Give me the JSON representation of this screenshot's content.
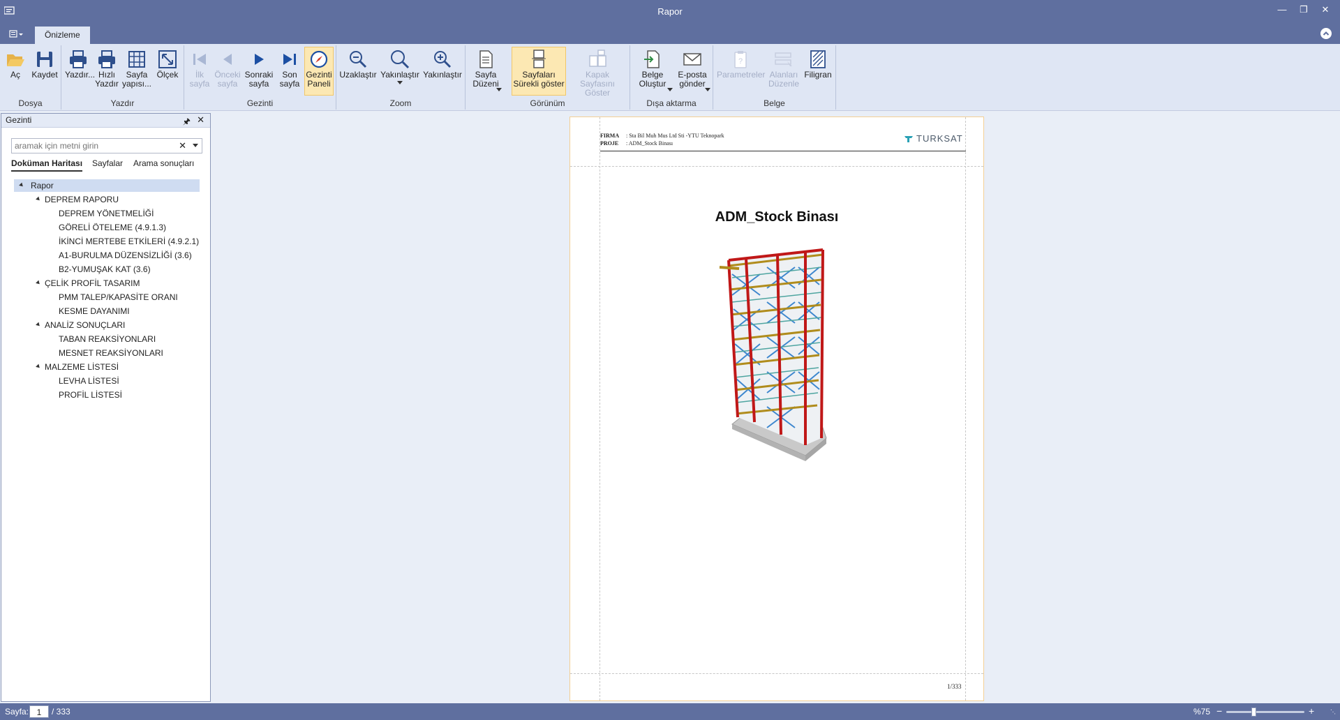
{
  "window": {
    "title": "Rapor"
  },
  "tabs": {
    "active": "Önizleme"
  },
  "ribbon": {
    "groups": {
      "dosya": "Dosya",
      "yazdir": "Yazdır",
      "gezinti": "Gezinti",
      "zoom": "Zoom",
      "gorunum": "Görünüm",
      "disa": "Dışa aktarma",
      "belge": "Belge"
    },
    "buttons": {
      "ac": "Aç",
      "kaydet": "Kaydet",
      "yazdir": "Yazdır...",
      "hizli_yazdir": "Hızlı\nYazdır",
      "sayfa_yapisi": "Sayfa\nyapısı...",
      "olcek": "Ölçek",
      "ilk_sayfa": "İlk\nsayfa",
      "onceki_sayfa": "Önceki\nsayfa",
      "sonraki_sayfa": "Sonraki\nsayfa",
      "son_sayfa": "Son\nsayfa",
      "gezinti_paneli": "Gezinti\nPaneli",
      "uzaklastir": "Uzaklaştır",
      "yakinlastir_dd": "Yakınlaştır",
      "yakinlastir": "Yakınlaştır",
      "sayfa_duzeni": "Sayfa\nDüzeni",
      "surekli_goster": "Sayfaları\nSürekli göster",
      "kapak_goster": "Kapak Sayfasını\nGöster",
      "belge_olustur": "Belge\nOluştur",
      "eposta_gonder": "E-posta\ngönder",
      "parametreler": "Parametreler",
      "alanlari_duzenle": "Alanları\nDüzenle",
      "filigran": "Filigran"
    }
  },
  "nav": {
    "title": "Gezinti",
    "search_placeholder": "aramak için metni girin",
    "tabs": [
      "Doküman Haritası",
      "Sayfalar",
      "Arama sonuçları"
    ],
    "tree": {
      "root": "Rapor",
      "deprem": "DEPREM RAPORU",
      "deprem_items": [
        "DEPREM YÖNETMELİĞİ",
        "GÖRELİ ÖTELEME (4.9.1.3)",
        "İKİNCİ MERTEBE ETKİLERİ (4.9.2.1)",
        "A1-BURULMA DÜZENSİZLİĞİ (3.6)",
        "B2-YUMUŞAK KAT (3.6)"
      ],
      "celik": "ÇELİK PROFİL TASARIM",
      "celik_items": [
        "PMM TALEP/KAPASİTE ORANI",
        "KESME DAYANIMI"
      ],
      "analiz": "ANALİZ SONUÇLARI",
      "analiz_items": [
        "TABAN REAKSİYONLARI",
        "MESNET REAKSİYONLARI"
      ],
      "malzeme": "MALZEME LİSTESİ",
      "malzeme_items": [
        "LEVHA LİSTESİ",
        "PROFİL LİSTESİ"
      ]
    }
  },
  "page": {
    "firma_label": "FIRMA",
    "firma_value": ": Sta Bil Muh Mus Ltd Sti -YTU Teknopark",
    "proje_label": "PROJE",
    "proje_value": ": ADM_Stock Binası",
    "logo": "TURKSAT",
    "title": "ADM_Stock Binası",
    "page_number": "1/333"
  },
  "status": {
    "label": "Sayfa:",
    "current": "1",
    "total": "/ 333",
    "zoom": "%75"
  },
  "colors": {
    "chrome": "#5f6f9f",
    "ribbon": "#dfe6f4",
    "active": "#fce8b3",
    "icon": "#2e4f8c"
  }
}
